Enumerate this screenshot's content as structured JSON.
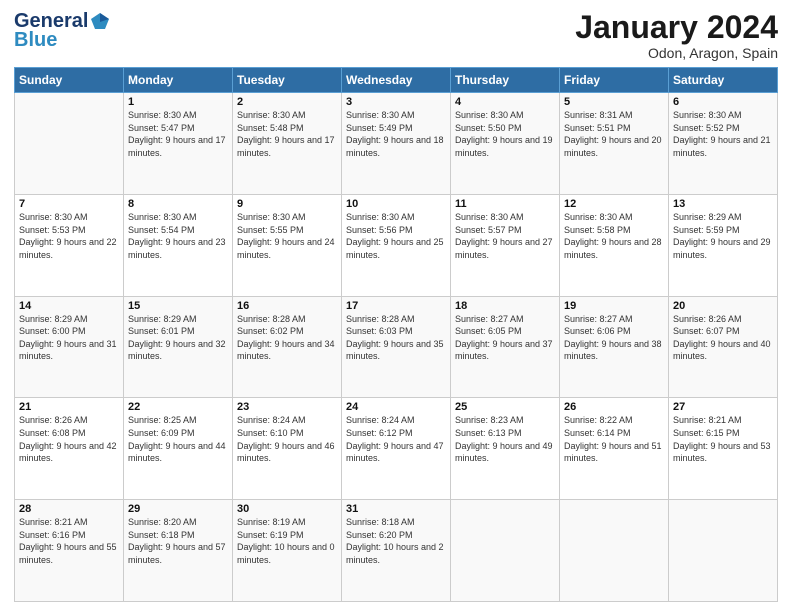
{
  "header": {
    "logo_general": "General",
    "logo_blue": "Blue",
    "month_title": "January 2024",
    "location": "Odon, Aragon, Spain"
  },
  "weekdays": [
    "Sunday",
    "Monday",
    "Tuesday",
    "Wednesday",
    "Thursday",
    "Friday",
    "Saturday"
  ],
  "weeks": [
    [
      {
        "day": "",
        "sunrise": "",
        "sunset": "",
        "daylight": ""
      },
      {
        "day": "1",
        "sunrise": "Sunrise: 8:30 AM",
        "sunset": "Sunset: 5:47 PM",
        "daylight": "Daylight: 9 hours and 17 minutes."
      },
      {
        "day": "2",
        "sunrise": "Sunrise: 8:30 AM",
        "sunset": "Sunset: 5:48 PM",
        "daylight": "Daylight: 9 hours and 17 minutes."
      },
      {
        "day": "3",
        "sunrise": "Sunrise: 8:30 AM",
        "sunset": "Sunset: 5:49 PM",
        "daylight": "Daylight: 9 hours and 18 minutes."
      },
      {
        "day": "4",
        "sunrise": "Sunrise: 8:30 AM",
        "sunset": "Sunset: 5:50 PM",
        "daylight": "Daylight: 9 hours and 19 minutes."
      },
      {
        "day": "5",
        "sunrise": "Sunrise: 8:31 AM",
        "sunset": "Sunset: 5:51 PM",
        "daylight": "Daylight: 9 hours and 20 minutes."
      },
      {
        "day": "6",
        "sunrise": "Sunrise: 8:30 AM",
        "sunset": "Sunset: 5:52 PM",
        "daylight": "Daylight: 9 hours and 21 minutes."
      }
    ],
    [
      {
        "day": "7",
        "sunrise": "Sunrise: 8:30 AM",
        "sunset": "Sunset: 5:53 PM",
        "daylight": "Daylight: 9 hours and 22 minutes."
      },
      {
        "day": "8",
        "sunrise": "Sunrise: 8:30 AM",
        "sunset": "Sunset: 5:54 PM",
        "daylight": "Daylight: 9 hours and 23 minutes."
      },
      {
        "day": "9",
        "sunrise": "Sunrise: 8:30 AM",
        "sunset": "Sunset: 5:55 PM",
        "daylight": "Daylight: 9 hours and 24 minutes."
      },
      {
        "day": "10",
        "sunrise": "Sunrise: 8:30 AM",
        "sunset": "Sunset: 5:56 PM",
        "daylight": "Daylight: 9 hours and 25 minutes."
      },
      {
        "day": "11",
        "sunrise": "Sunrise: 8:30 AM",
        "sunset": "Sunset: 5:57 PM",
        "daylight": "Daylight: 9 hours and 27 minutes."
      },
      {
        "day": "12",
        "sunrise": "Sunrise: 8:30 AM",
        "sunset": "Sunset: 5:58 PM",
        "daylight": "Daylight: 9 hours and 28 minutes."
      },
      {
        "day": "13",
        "sunrise": "Sunrise: 8:29 AM",
        "sunset": "Sunset: 5:59 PM",
        "daylight": "Daylight: 9 hours and 29 minutes."
      }
    ],
    [
      {
        "day": "14",
        "sunrise": "Sunrise: 8:29 AM",
        "sunset": "Sunset: 6:00 PM",
        "daylight": "Daylight: 9 hours and 31 minutes."
      },
      {
        "day": "15",
        "sunrise": "Sunrise: 8:29 AM",
        "sunset": "Sunset: 6:01 PM",
        "daylight": "Daylight: 9 hours and 32 minutes."
      },
      {
        "day": "16",
        "sunrise": "Sunrise: 8:28 AM",
        "sunset": "Sunset: 6:02 PM",
        "daylight": "Daylight: 9 hours and 34 minutes."
      },
      {
        "day": "17",
        "sunrise": "Sunrise: 8:28 AM",
        "sunset": "Sunset: 6:03 PM",
        "daylight": "Daylight: 9 hours and 35 minutes."
      },
      {
        "day": "18",
        "sunrise": "Sunrise: 8:27 AM",
        "sunset": "Sunset: 6:05 PM",
        "daylight": "Daylight: 9 hours and 37 minutes."
      },
      {
        "day": "19",
        "sunrise": "Sunrise: 8:27 AM",
        "sunset": "Sunset: 6:06 PM",
        "daylight": "Daylight: 9 hours and 38 minutes."
      },
      {
        "day": "20",
        "sunrise": "Sunrise: 8:26 AM",
        "sunset": "Sunset: 6:07 PM",
        "daylight": "Daylight: 9 hours and 40 minutes."
      }
    ],
    [
      {
        "day": "21",
        "sunrise": "Sunrise: 8:26 AM",
        "sunset": "Sunset: 6:08 PM",
        "daylight": "Daylight: 9 hours and 42 minutes."
      },
      {
        "day": "22",
        "sunrise": "Sunrise: 8:25 AM",
        "sunset": "Sunset: 6:09 PM",
        "daylight": "Daylight: 9 hours and 44 minutes."
      },
      {
        "day": "23",
        "sunrise": "Sunrise: 8:24 AM",
        "sunset": "Sunset: 6:10 PM",
        "daylight": "Daylight: 9 hours and 46 minutes."
      },
      {
        "day": "24",
        "sunrise": "Sunrise: 8:24 AM",
        "sunset": "Sunset: 6:12 PM",
        "daylight": "Daylight: 9 hours and 47 minutes."
      },
      {
        "day": "25",
        "sunrise": "Sunrise: 8:23 AM",
        "sunset": "Sunset: 6:13 PM",
        "daylight": "Daylight: 9 hours and 49 minutes."
      },
      {
        "day": "26",
        "sunrise": "Sunrise: 8:22 AM",
        "sunset": "Sunset: 6:14 PM",
        "daylight": "Daylight: 9 hours and 51 minutes."
      },
      {
        "day": "27",
        "sunrise": "Sunrise: 8:21 AM",
        "sunset": "Sunset: 6:15 PM",
        "daylight": "Daylight: 9 hours and 53 minutes."
      }
    ],
    [
      {
        "day": "28",
        "sunrise": "Sunrise: 8:21 AM",
        "sunset": "Sunset: 6:16 PM",
        "daylight": "Daylight: 9 hours and 55 minutes."
      },
      {
        "day": "29",
        "sunrise": "Sunrise: 8:20 AM",
        "sunset": "Sunset: 6:18 PM",
        "daylight": "Daylight: 9 hours and 57 minutes."
      },
      {
        "day": "30",
        "sunrise": "Sunrise: 8:19 AM",
        "sunset": "Sunset: 6:19 PM",
        "daylight": "Daylight: 10 hours and 0 minutes."
      },
      {
        "day": "31",
        "sunrise": "Sunrise: 8:18 AM",
        "sunset": "Sunset: 6:20 PM",
        "daylight": "Daylight: 10 hours and 2 minutes."
      },
      {
        "day": "",
        "sunrise": "",
        "sunset": "",
        "daylight": ""
      },
      {
        "day": "",
        "sunrise": "",
        "sunset": "",
        "daylight": ""
      },
      {
        "day": "",
        "sunrise": "",
        "sunset": "",
        "daylight": ""
      }
    ]
  ]
}
